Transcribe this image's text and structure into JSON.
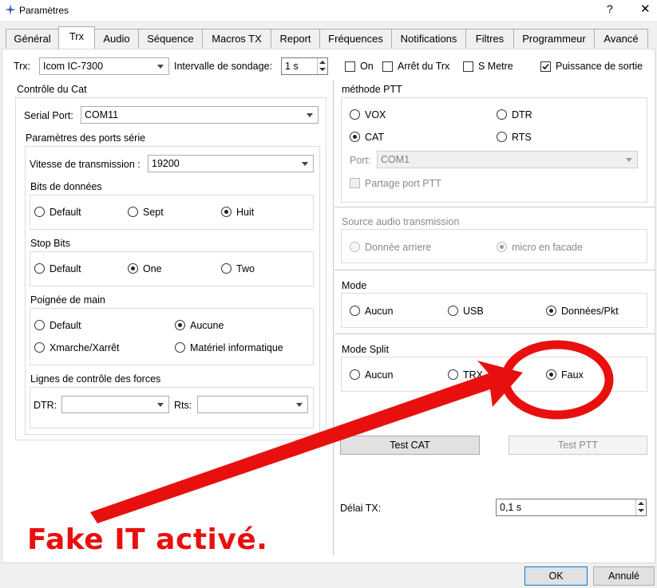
{
  "window": {
    "title": "Paramètres",
    "help": "?",
    "close": "✕"
  },
  "tabs": [
    "Général",
    "Trx",
    "Audio",
    "Séquence",
    "Macros TX",
    "Report",
    "Fréquences",
    "Notifications",
    "Filtres",
    "Programmeur",
    "Avancé"
  ],
  "active_tab": "Trx",
  "top_row": {
    "trx_label": "Trx:",
    "trx_value": "Icom IC-7300",
    "poll_label": "Intervalle de sondage:",
    "poll_value": "1 s",
    "on_label": "On",
    "on_checked": false,
    "arret_label": "Arrêt du Trx",
    "arret_checked": false,
    "smetre_label": "S Metre",
    "smetre_checked": false,
    "puissance_label": "Puissance de sortie",
    "puissance_checked": true
  },
  "cat": {
    "title": "Contrôle du Cat",
    "serial_label": "Serial Port:",
    "serial_value": "COM11",
    "ports_title": "Paramètres des ports série",
    "baud_label": "Vitesse de transmission :",
    "baud_value": "19200",
    "databits_title": "Bits de données",
    "databits": {
      "options": [
        "Default",
        "Sept",
        "Huit"
      ],
      "selected": "Huit"
    },
    "stopbits_title": "Stop Bits",
    "stopbits": {
      "options": [
        "Default",
        "One",
        "Two"
      ],
      "selected": "One"
    },
    "handshake_title": "Poignée de main",
    "handshake": {
      "options": [
        "Default",
        "Aucune",
        "Xmarche/Xarrêt",
        "Matériel informatique"
      ],
      "selected": "Aucune"
    },
    "force_title": "Lignes de contrôle des forces",
    "dtr_label": "DTR:",
    "dtr_value": "",
    "rts_label": "Rts:",
    "rts_value": ""
  },
  "ptt": {
    "title": "méthode PTT",
    "options": [
      "VOX",
      "DTR",
      "CAT",
      "RTS"
    ],
    "selected": "CAT",
    "port_label": "Port:",
    "port_value": "COM1",
    "share_label": "Partage port PTT",
    "share_checked": false
  },
  "audio_source": {
    "title": "Source audio transmission",
    "options": [
      "Donnée arriere",
      "micro en facade"
    ],
    "selected": "micro en facade"
  },
  "mode": {
    "title": "Mode",
    "options": [
      "Aucun",
      "USB",
      "Données/Pkt"
    ],
    "selected": "Données/Pkt"
  },
  "split": {
    "title": "Mode Split",
    "options": [
      "Aucun",
      "TRX",
      "Faux"
    ],
    "selected": "Faux"
  },
  "buttons": {
    "test_cat": "Test CAT",
    "test_ptt": "Test PTT",
    "ok": "OK",
    "cancel": "Annulé"
  },
  "delay": {
    "label": "Délai TX:",
    "value": "0,1 s"
  },
  "annotation": {
    "text": "Fake IT activé.",
    "color": "#e8100f"
  }
}
